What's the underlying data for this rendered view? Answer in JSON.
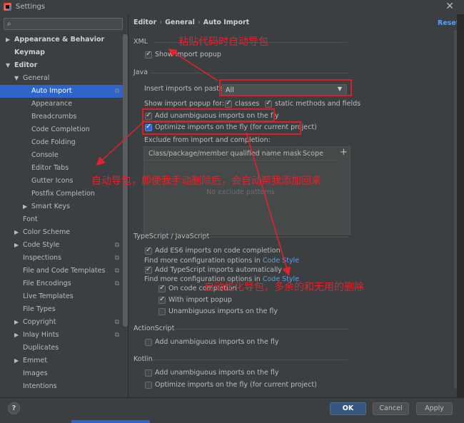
{
  "window": {
    "title": "Settings"
  },
  "search": {
    "placeholder": ""
  },
  "tree": [
    {
      "label": "Appearance & Behavior",
      "arrow": "▶",
      "bold": true
    },
    {
      "label": "Keymap",
      "arrow": "",
      "bold": true
    },
    {
      "label": "Editor",
      "arrow": "▼",
      "bold": true
    },
    {
      "label": "General",
      "arrow": "▼"
    },
    {
      "label": "Auto Import",
      "selected": true,
      "cfg": true
    },
    {
      "label": "Appearance"
    },
    {
      "label": "Breadcrumbs"
    },
    {
      "label": "Code Completion"
    },
    {
      "label": "Code Folding"
    },
    {
      "label": "Console"
    },
    {
      "label": "Editor Tabs"
    },
    {
      "label": "Gutter Icons"
    },
    {
      "label": "Postfix Completion"
    },
    {
      "label": "Smart Keys",
      "arrow": "▶"
    },
    {
      "label": "Font"
    },
    {
      "label": "Color Scheme",
      "arrow": "▶"
    },
    {
      "label": "Code Style",
      "arrow": "▶",
      "cfg": true
    },
    {
      "label": "Inspections",
      "cfg": true
    },
    {
      "label": "File and Code Templates",
      "cfg": true
    },
    {
      "label": "File Encodings",
      "cfg": true
    },
    {
      "label": "Live Templates"
    },
    {
      "label": "File Types"
    },
    {
      "label": "Copyright",
      "arrow": "▶",
      "cfg": true
    },
    {
      "label": "Inlay Hints",
      "arrow": "▶",
      "cfg": true
    },
    {
      "label": "Duplicates"
    },
    {
      "label": "Emmet",
      "arrow": "▶"
    },
    {
      "label": "Images"
    },
    {
      "label": "Intentions"
    }
  ],
  "breadcrumb": {
    "part1": "Editor",
    "part2": "General",
    "part3": "Auto Import",
    "sep": "›"
  },
  "reset_label": "Reset",
  "xml": {
    "heading": "XML",
    "show_popup": "Show import popup"
  },
  "java": {
    "heading": "Java",
    "insert_label": "Insert imports on paste:",
    "insert_value": "All",
    "show_popup_label": "Show import popup for:",
    "classes": "classes",
    "static": "static methods and fields",
    "add_unambiguous": "Add unambiguous imports on the fly",
    "optimize": "Optimize imports on the fly (for current project)",
    "exclude_label": "Exclude from import and completion:",
    "col1": "Class/package/member qualified name mask",
    "col2": "Scope",
    "empty": "No exclude patterns",
    "plus": "+"
  },
  "ts": {
    "heading": "TypeScript / JavaScript",
    "es6": "Add ES6 imports on code completion",
    "more1": "Find more configuration options in ",
    "more_link": "Code Style",
    "ts_auto": "Add TypeScript imports automatically",
    "more2": "Find more configuration options in ",
    "on_completion": "On code completion",
    "with_popup": "With import popup",
    "unambiguous": "Unambiguous imports on the fly"
  },
  "actionscript": {
    "heading": "ActionScript",
    "add_unambiguous": "Add unambiguous imports on the fly"
  },
  "kotlin": {
    "heading": "Kotlin",
    "add_unambiguous": "Add unambiguous imports on the fly",
    "optimize": "Optimize imports on the fly (for current project)"
  },
  "buttons": {
    "help": "?",
    "ok": "OK",
    "cancel": "Cancel",
    "apply": "Apply"
  },
  "annotations": {
    "paste": "粘贴代码时自动导包",
    "auto": "自动导包，即使我手动删除后，会自动帮我添加回来",
    "optimize": "自动优化导包，多余的和无用的删除"
  },
  "colors": {
    "accent": "#2f65ca",
    "link": "#589df6",
    "annotation": "#e8202a"
  }
}
